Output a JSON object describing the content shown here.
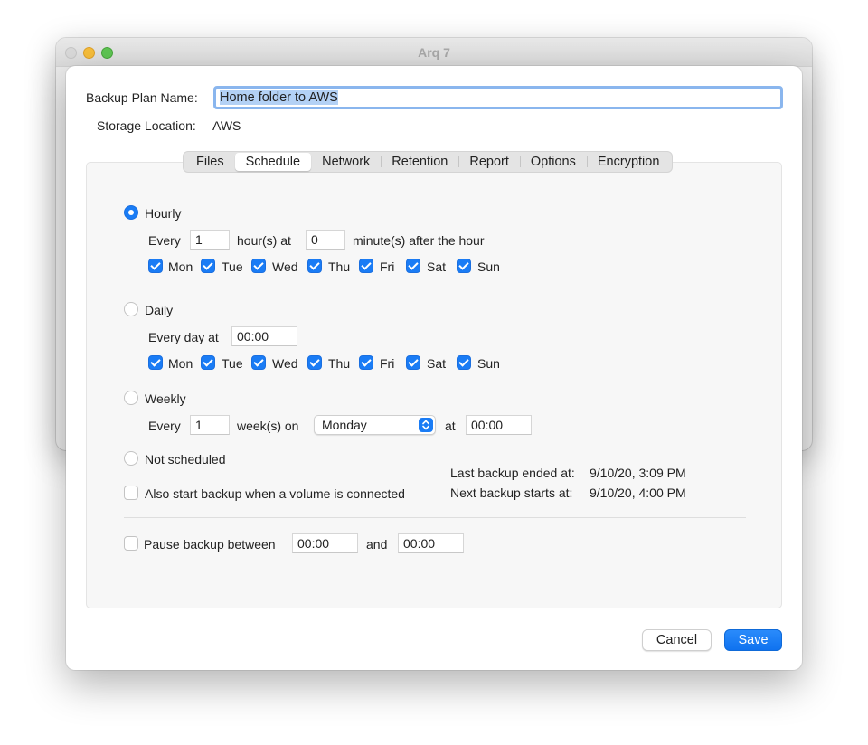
{
  "window": {
    "title": "Arq 7"
  },
  "form": {
    "plan_name_label": "Backup Plan Name:",
    "plan_name_value": "Home folder to AWS",
    "storage_label": "Storage Location:",
    "storage_value": "AWS"
  },
  "tabs": [
    "Files",
    "Schedule",
    "Network",
    "Retention",
    "Report",
    "Options",
    "Encryption"
  ],
  "active_tab": "Schedule",
  "schedule": {
    "hourly": {
      "label": "Hourly",
      "selected": true,
      "every_label": "Every",
      "hours_value": "1",
      "hours_at_label": "hour(s) at",
      "minutes_value": "0",
      "minutes_label": "minute(s) after the hour"
    },
    "daily": {
      "label": "Daily",
      "selected": false,
      "every_day_label": "Every day at",
      "time_value": "00:00"
    },
    "weekly": {
      "label": "Weekly",
      "selected": false,
      "every_label": "Every",
      "weeks_value": "1",
      "weeks_on_label": "week(s) on",
      "day_value": "Monday",
      "at_label": "at",
      "time_value": "00:00"
    },
    "not_scheduled": {
      "label": "Not scheduled",
      "selected": false
    },
    "days": [
      "Mon",
      "Tue",
      "Wed",
      "Thu",
      "Fri",
      "Sat",
      "Sun"
    ],
    "volume_connected_label": "Also start backup when a volume is connected",
    "last_backup_label": "Last backup ended at:",
    "last_backup_value": "9/10/20, 3:09 PM",
    "next_backup_label": "Next backup starts at:",
    "next_backup_value": "9/10/20, 4:00 PM",
    "pause_label": "Pause backup between",
    "pause_start": "00:00",
    "pause_and_label": "and",
    "pause_end": "00:00"
  },
  "buttons": {
    "cancel": "Cancel",
    "save": "Save"
  },
  "colors": {
    "accent": "#1a7cf5",
    "selection": "#b3d1f5"
  }
}
